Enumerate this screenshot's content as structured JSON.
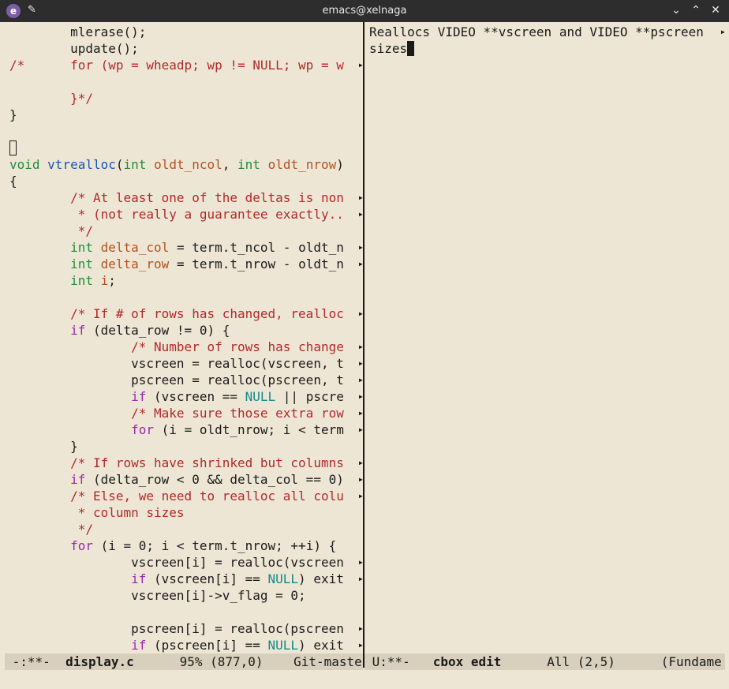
{
  "window": {
    "title": "emacs@xelnaga"
  },
  "left_pane": {
    "lines": [
      [
        {
          "t": "        mlerase();"
        }
      ],
      [
        {
          "t": "        update();"
        }
      ],
      [
        {
          "t": "/*      for (wp = wheadp; wp != NULL; wp = w",
          "c": "cm"
        }
      ],
      [
        {
          "t": ""
        }
      ],
      [
        {
          "t": "        }*/",
          "c": "cm"
        }
      ],
      [
        {
          "t": "}"
        }
      ],
      [
        {
          "t": ""
        }
      ],
      [
        {
          "t": "",
          "cursor": "box"
        }
      ],
      [
        {
          "t": "void",
          "c": "ty"
        },
        {
          "t": " "
        },
        {
          "t": "vtrealloc",
          "c": "fn"
        },
        {
          "t": "("
        },
        {
          "t": "int",
          "c": "ty"
        },
        {
          "t": " "
        },
        {
          "t": "oldt_ncol",
          "c": "vr"
        },
        {
          "t": ", "
        },
        {
          "t": "int",
          "c": "ty"
        },
        {
          "t": " "
        },
        {
          "t": "oldt_nrow",
          "c": "vr"
        },
        {
          "t": ")"
        }
      ],
      [
        {
          "t": "{"
        }
      ],
      [
        {
          "t": "        "
        },
        {
          "t": "/* At least one of the deltas is non",
          "c": "cm"
        }
      ],
      [
        {
          "t": "         * (not really a guarantee exactly..",
          "c": "cm"
        }
      ],
      [
        {
          "t": "         */",
          "c": "cm"
        }
      ],
      [
        {
          "t": "        "
        },
        {
          "t": "int",
          "c": "ty"
        },
        {
          "t": " "
        },
        {
          "t": "delta_col",
          "c": "vr"
        },
        {
          "t": " = term.t_ncol - oldt_n"
        }
      ],
      [
        {
          "t": "        "
        },
        {
          "t": "int",
          "c": "ty"
        },
        {
          "t": " "
        },
        {
          "t": "delta_row",
          "c": "vr"
        },
        {
          "t": " = term.t_nrow - oldt_n"
        }
      ],
      [
        {
          "t": "        "
        },
        {
          "t": "int",
          "c": "ty"
        },
        {
          "t": " "
        },
        {
          "t": "i",
          "c": "vr"
        },
        {
          "t": ";"
        }
      ],
      [
        {
          "t": ""
        }
      ],
      [
        {
          "t": "        "
        },
        {
          "t": "/* If # of rows has changed, realloc",
          "c": "cm"
        }
      ],
      [
        {
          "t": "        "
        },
        {
          "t": "if",
          "c": "kw"
        },
        {
          "t": " (delta_row != 0) {"
        }
      ],
      [
        {
          "t": "                "
        },
        {
          "t": "/* Number of rows has change",
          "c": "cm"
        }
      ],
      [
        {
          "t": "                vscreen = realloc(vscreen, t"
        }
      ],
      [
        {
          "t": "                pscreen = realloc(pscreen, t"
        }
      ],
      [
        {
          "t": "                "
        },
        {
          "t": "if",
          "c": "kw"
        },
        {
          "t": " (vscreen == "
        },
        {
          "t": "NULL",
          "c": "cs"
        },
        {
          "t": " || pscre"
        }
      ],
      [
        {
          "t": "                "
        },
        {
          "t": "/* Make sure those extra row",
          "c": "cm"
        }
      ],
      [
        {
          "t": "                "
        },
        {
          "t": "for",
          "c": "kw"
        },
        {
          "t": " (i = oldt_nrow; i < term"
        }
      ],
      [
        {
          "t": "        }"
        }
      ],
      [
        {
          "t": "        "
        },
        {
          "t": "/* If rows have shrinked but columns",
          "c": "cm"
        }
      ],
      [
        {
          "t": "        "
        },
        {
          "t": "if",
          "c": "kw"
        },
        {
          "t": " (delta_row < 0 && delta_col == 0)"
        }
      ],
      [
        {
          "t": "        "
        },
        {
          "t": "/* Else, we need to realloc all colu",
          "c": "cm"
        }
      ],
      [
        {
          "t": "         * column sizes",
          "c": "cm"
        }
      ],
      [
        {
          "t": "         */",
          "c": "cm"
        }
      ],
      [
        {
          "t": "        "
        },
        {
          "t": "for",
          "c": "kw"
        },
        {
          "t": " (i = 0; i < term.t_nrow; ++i) {"
        }
      ],
      [
        {
          "t": "                vscreen[i] = realloc(vscreen"
        }
      ],
      [
        {
          "t": "                "
        },
        {
          "t": "if",
          "c": "kw"
        },
        {
          "t": " (vscreen[i] == "
        },
        {
          "t": "NULL",
          "c": "cs"
        },
        {
          "t": ") exit"
        }
      ],
      [
        {
          "t": "                vscreen[i]->v_flag = 0;"
        }
      ],
      [
        {
          "t": ""
        }
      ],
      [
        {
          "t": "                pscreen[i] = realloc(pscreen"
        }
      ],
      [
        {
          "t": "                "
        },
        {
          "t": "if",
          "c": "kw"
        },
        {
          "t": " (pscreen[i] == "
        },
        {
          "t": "NULL",
          "c": "cs"
        },
        {
          "t": ") exit"
        }
      ]
    ],
    "truncated_lines": [
      2,
      10,
      11,
      13,
      14,
      17,
      19,
      20,
      21,
      22,
      23,
      24,
      26,
      27,
      28,
      32,
      33,
      36,
      37
    ]
  },
  "right_pane": {
    "lines": [
      [
        {
          "t": "Reallocs VIDEO **vscreen and VIDEO **pscreen"
        }
      ],
      [
        {
          "t": "sizes"
        },
        {
          "t": "",
          "cursor": "solid"
        }
      ]
    ],
    "truncated_lines": [
      0
    ]
  },
  "modeline_left": {
    "status": " -:**-  ",
    "buffer": "display.c",
    "position": "      95% (877,0)    ",
    "vc": "Git-maste"
  },
  "modeline_right": {
    "status": " U:**-   ",
    "buffer": "cbox edit",
    "position": "      All (2,5)      ",
    "mode": "(Fundame"
  }
}
